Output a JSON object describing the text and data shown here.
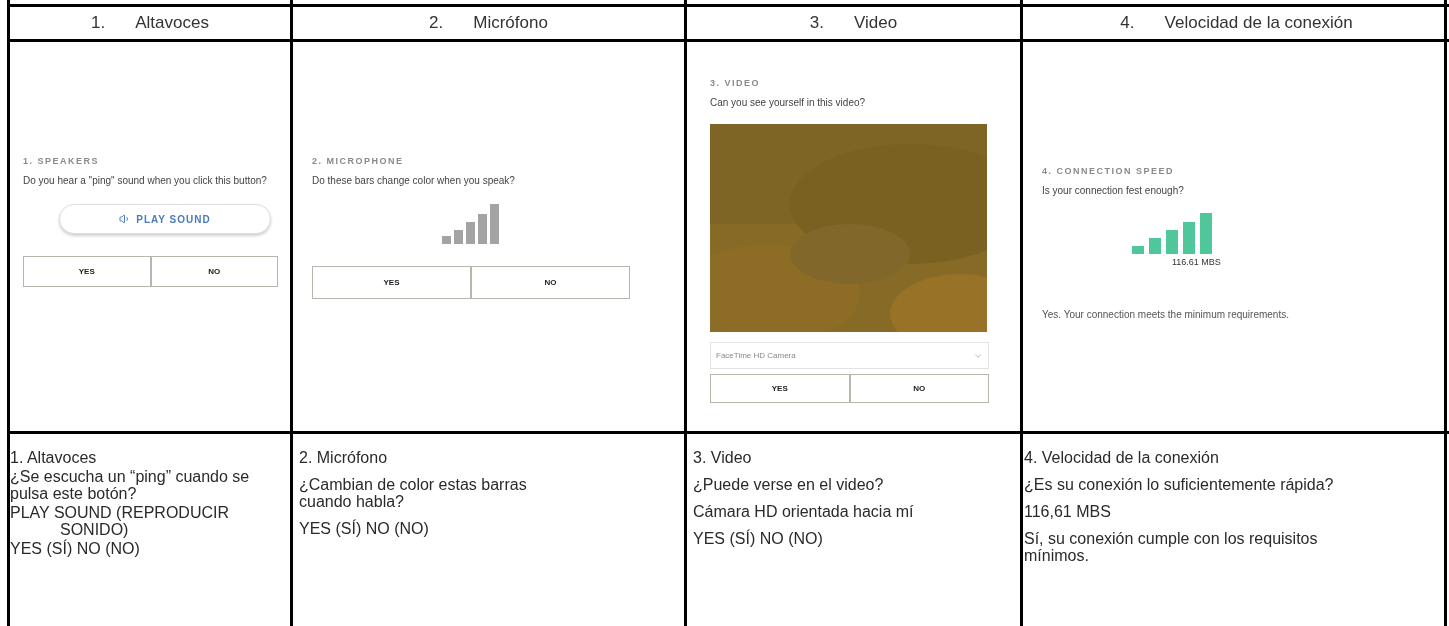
{
  "columns": [
    {
      "kind": "speakers",
      "number": "1.",
      "label": "Altavoces",
      "panel": {
        "heading": "1. SPEAKERS",
        "question": "Do you hear a \"ping\" sound when you click this button?",
        "play_button": "PLAY SOUND",
        "buttons": [
          "YES",
          "NO"
        ]
      },
      "notes": [
        "1. Altavoces",
        "¿Se escucha un “ping” cuando se pulsa este botón?",
        "PLAY SOUND (REPRODUCIR SONIDO)",
        "YES (SÍ) NO (NO)"
      ]
    },
    {
      "kind": "microphone",
      "number": "2.",
      "label": "Micrófono",
      "panel": {
        "heading": "2. MICROPHONE",
        "question": "Do these bars change color when you speak?",
        "buttons": [
          "YES",
          "NO"
        ]
      },
      "notes": [
        "2. Micrófono",
        "¿Cambian de color estas barras cuando habla?",
        "YES (SÍ) NO (NO)"
      ]
    },
    {
      "kind": "video",
      "number": "3.",
      "label": "Video",
      "panel": {
        "heading": "3. VIDEO",
        "question": "Can you see yourself in this video?",
        "video": {
          "kind": "picture"
        },
        "camera_select": "FaceTime HD Camera",
        "buttons": [
          "YES",
          "NO"
        ]
      },
      "notes": [
        "3. Video",
        "¿Puede verse en el video?",
        "Cámara HD orientada hacia mí",
        "YES (SÍ) NO (NO)"
      ]
    },
    {
      "kind": "speed",
      "number": "4.",
      "label": "Velocidad de la conexión",
      "panel": {
        "heading": "4. CONNECTION SPEED",
        "question": "Is your connection fest enough?",
        "reading": "116.61 MBS",
        "result": "Yes. Your connection meets the minimum requirements."
      },
      "notes": [
        "4. Velocidad de la conexión",
        "¿Es su conexión lo suficientemente rápida?",
        "116,61 MBS",
        "Sí, su conexión cumple con los requisitos mínimos."
      ]
    }
  ]
}
